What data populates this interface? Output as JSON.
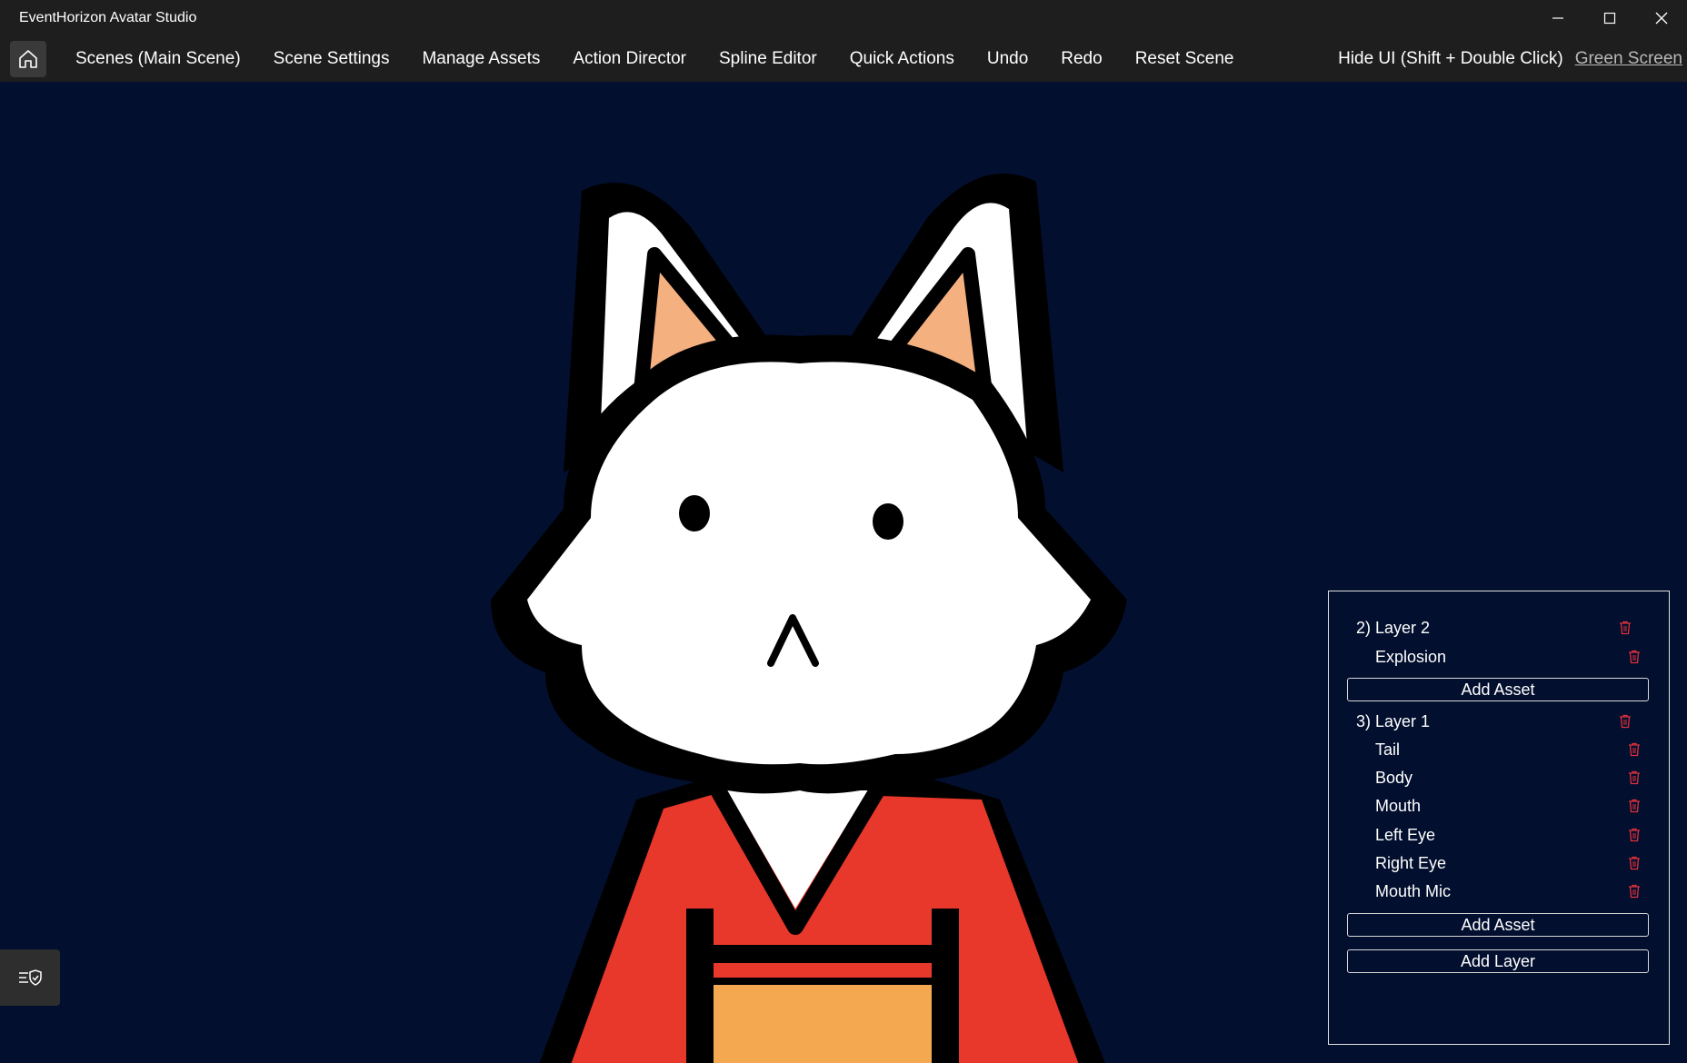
{
  "window": {
    "title": "EventHorizon Avatar Studio",
    "controls": [
      "minimize-icon",
      "maximize-icon",
      "close-icon"
    ]
  },
  "menu": {
    "home_icon": "home-icon",
    "items": [
      "Scenes (Main Scene)",
      "Scene Settings",
      "Manage Assets",
      "Action Director",
      "Spline Editor",
      "Quick Actions",
      "Undo",
      "Redo",
      "Reset Scene"
    ],
    "hide_ui": "Hide UI (Shift + Double Click)",
    "green_screen": "Green Screen"
  },
  "panel": {
    "layers": [
      {
        "title": "2) Layer 2",
        "assets": [
          "Explosion"
        ],
        "add_asset_label": "Add Asset"
      },
      {
        "title": "3) Layer 1",
        "assets": [
          "Tail",
          "Body",
          "Mouth",
          "Left Eye",
          "Right Eye",
          "Mouth Mic"
        ],
        "add_asset_label": "Add Asset"
      }
    ],
    "add_layer_label": "Add Layer",
    "delete_icon": "trash-icon"
  },
  "side_toggle": {
    "icon": "list-shield-icon"
  },
  "colors": {
    "background": "#020f2e",
    "toolbar": "#1e1e1e",
    "trash": "#e0303a",
    "kimono": "#e8372b",
    "ear_inner": "#f5b080",
    "obi": "#f4a850"
  }
}
